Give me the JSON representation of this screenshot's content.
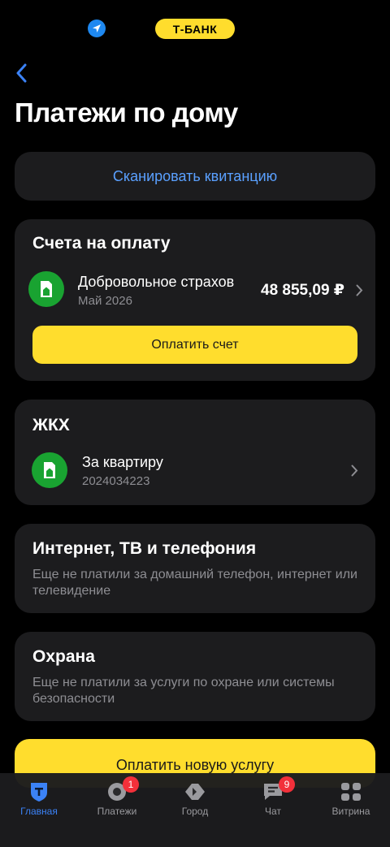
{
  "status_bar": {
    "brand_pill": "Т-БАНК"
  },
  "header": {
    "title": "Платежи по дому"
  },
  "scan": {
    "label": "Сканировать квитанцию"
  },
  "bills": {
    "heading": "Счета на оплату",
    "item": {
      "title": "Добровольное страхов",
      "subtitle": "Май 2026",
      "amount": "48 855,09 ₽"
    },
    "pay_button": "Оплатить счет"
  },
  "utilities": {
    "heading": "ЖКХ",
    "item": {
      "title": "За квартиру",
      "subtitle": "2024034223"
    }
  },
  "internet": {
    "heading": "Интернет, ТВ и телефония",
    "description": "Еще не платили за домашний телефон, интернет или телевидение"
  },
  "security": {
    "heading": "Охрана",
    "description": "Еще не платили за услуги по охране или системы безопасности"
  },
  "new_service_button": "Оплатить новую услугу",
  "tabbar": {
    "items": [
      {
        "label": "Главная",
        "icon": "bank-shield-icon",
        "active": true
      },
      {
        "label": "Платежи",
        "icon": "payments-icon",
        "badge": "1"
      },
      {
        "label": "Город",
        "icon": "city-icon"
      },
      {
        "label": "Чат",
        "icon": "chat-icon",
        "badge": "9"
      },
      {
        "label": "Витрина",
        "icon": "showcase-icon"
      }
    ]
  },
  "colors": {
    "accent_yellow": "#ffdd2d",
    "link_blue": "#5aa0ff",
    "card_bg": "#1c1c1e",
    "icon_green": "#19a331",
    "badge_red": "#f2303a"
  }
}
